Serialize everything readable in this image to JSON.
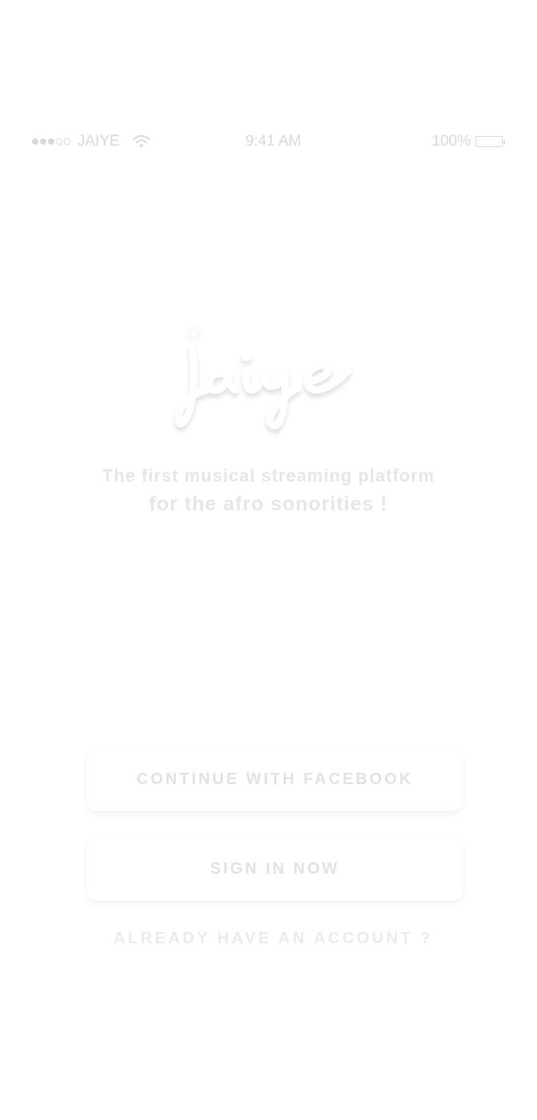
{
  "status_bar": {
    "carrier": "JAIYE",
    "time": "9:41 AM",
    "battery_percent": "100%",
    "signal_bars_filled": 3,
    "signal_bars_total": 5,
    "battery_level": 1.0,
    "icons": [
      "signal-dots-icon",
      "wifi-icon",
      "battery-icon"
    ]
  },
  "logo": {
    "text": "jaiye",
    "icon": "jaiye-logo"
  },
  "tagline": {
    "line1": "The first musical streaming platform",
    "line2": "for the afro sonorities !"
  },
  "actions": {
    "facebook_label": "CONTINUE WITH FACEBOOK",
    "signin_label": "SIGN IN NOW",
    "account_label": "ALREADY HAVE AN ACCOUNT ?"
  },
  "colors": {
    "background": "#ffffff",
    "text": "#e2e2e2",
    "status": "#d9d9d9"
  }
}
